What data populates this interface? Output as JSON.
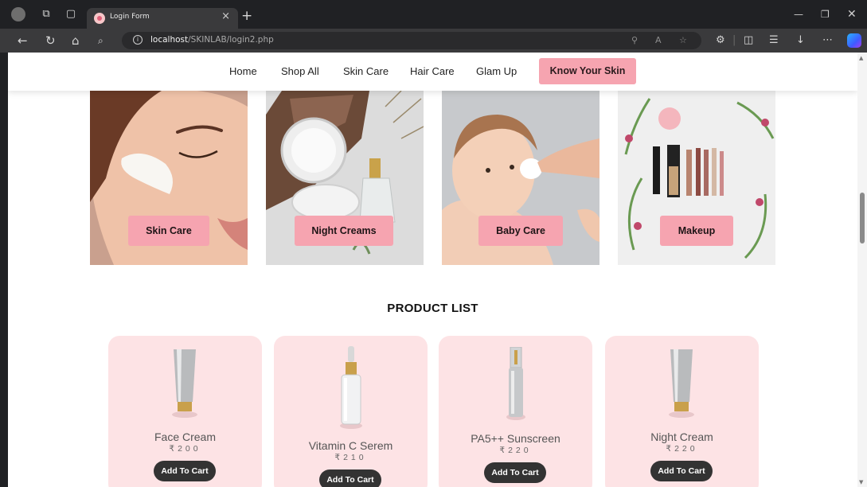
{
  "browser": {
    "tab_title": "Login Form",
    "url_host": "localhost",
    "url_path": "/SKINLAB/login2.php"
  },
  "nav": {
    "items": [
      "Home",
      "Shop All",
      "Skin Care",
      "Hair Care",
      "Glam Up"
    ],
    "cta": "Know Your Skin"
  },
  "categories": [
    {
      "label": "Skin Care",
      "image": "face-cream-application-photo"
    },
    {
      "label": "Night Creams",
      "image": "cream-jars-on-bark-photo"
    },
    {
      "label": "Baby Care",
      "image": "baby-cotton-pad-photo"
    },
    {
      "label": "Makeup",
      "image": "makeup-products-flatlay-photo"
    }
  ],
  "product_list": {
    "title": "PRODUCT LIST",
    "products": [
      {
        "name": "Face Cream",
        "price": "₹200",
        "button": "Add To Cart",
        "image": "silver-tube"
      },
      {
        "name": "Vitamin C Serem",
        "price": "₹210",
        "button": "Add To Cart",
        "image": "dropper-bottle"
      },
      {
        "name": "PA5++ Sunscreen",
        "price": "₹220",
        "button": "Add To Cart",
        "image": "spray-bottle"
      },
      {
        "name": "Night Cream",
        "price": "₹220",
        "button": "Add To Cart",
        "image": "silver-tube"
      }
    ]
  },
  "colors": {
    "accent_pink": "#f6a4b0",
    "card_pink": "#fde3e5",
    "dark_button": "#333333"
  }
}
